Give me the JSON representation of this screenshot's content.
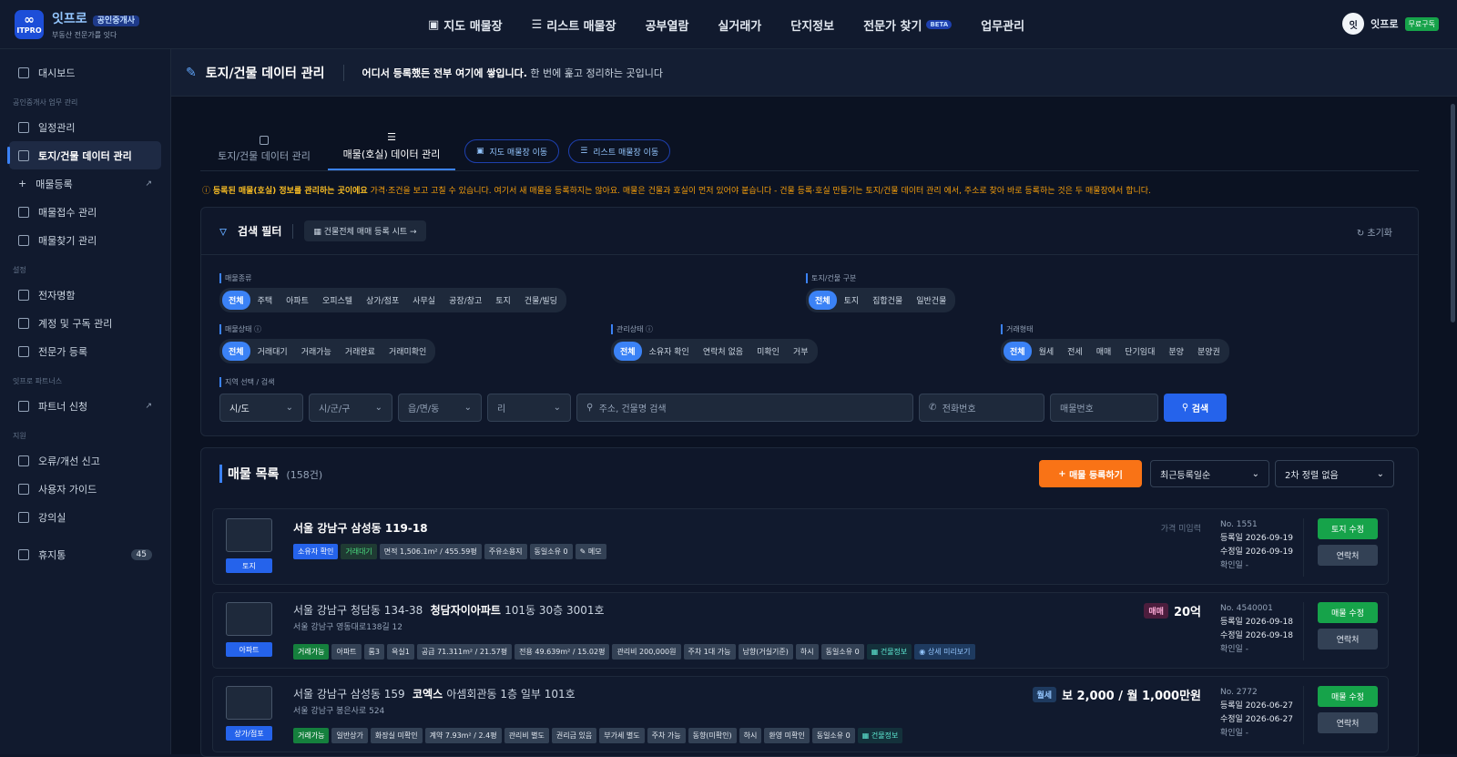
{
  "brand": {
    "name": "잇프로",
    "badge": "공인중개사",
    "tagline": "부동산 전문가를 잇다",
    "logo_text": "ITPRO"
  },
  "nav": [
    "지도 매물장",
    "리스트 매물장",
    "공부열람",
    "실거래가",
    "단지정보",
    "전문가 찾기",
    "업무관리"
  ],
  "nav_beta": "BETA",
  "user": {
    "avatar": "잇",
    "name": "잇프로",
    "plan": "무료구독"
  },
  "sidebar": {
    "dashboard": "대시보드",
    "sec1": "공인중개사 업무 관리",
    "items1": [
      "일정관리",
      "토지/건물 데이터 관리",
      "매물등록",
      "매물접수 관리",
      "매물찾기 관리"
    ],
    "sec2": "설정",
    "items2": [
      "전자명함",
      "계정 및 구독 관리",
      "전문가 등록"
    ],
    "sec3": "잇프로 파트너스",
    "items3": [
      "파트너 신청"
    ],
    "sec4": "지원",
    "items4": [
      "오류/개선 신고",
      "사용자 가이드",
      "강의실"
    ],
    "trash": "휴지통",
    "trash_count": "45"
  },
  "header": {
    "title": "토지/건물 데이터 관리",
    "desc_bold": "어디서 등록했든 전부 여기에 쌓입니다.",
    "desc": " 한 번에 훑고 정리하는 곳입니다"
  },
  "tabs": [
    "토지/건물 데이터 관리",
    "매물(호실) 데이터 관리"
  ],
  "tab_buttons": [
    "지도 매물장 이동",
    "리스트 매물장 이동"
  ],
  "notice": {
    "bold": "등록된 매물(호실) 정보를 관리하는 곳이에요",
    "text": " 가격·조건을 보고 고칠 수 있습니다. 여기서 새 매물을 등록하지는 않아요. 매물은 건물과 호실이 먼저 있어야 붙습니다 - 건물 등록·호실 만들기는 토지/건물 데이터 관리 에서, 주소로 찾아 바로 등록하는 것은 두 매물장에서 합니다."
  },
  "filter": {
    "title": "검색 필터",
    "sheet": "건물전체 매매 등록 시트",
    "reset": "초기화",
    "type_label": "매물종류",
    "types": [
      "전체",
      "주택",
      "아파트",
      "오피스텔",
      "상가/점포",
      "사무실",
      "공장/창고",
      "토지",
      "건물/빌딩"
    ],
    "land_label": "토지/건물 구분",
    "lands": [
      "전체",
      "토지",
      "집합건물",
      "일반건물"
    ],
    "status_label": "매물상태",
    "statuses": [
      "전체",
      "거래대기",
      "거래가능",
      "거래완료",
      "거래미확인"
    ],
    "manage_label": "관리상태",
    "manages": [
      "전체",
      "소유자 확인",
      "연락처 없음",
      "미확인",
      "거부"
    ],
    "deal_label": "거래형태",
    "deals": [
      "전체",
      "월세",
      "전세",
      "매매",
      "단기임대",
      "분양",
      "분양권"
    ],
    "region_label": "지역 선택 / 검색",
    "sido": "시/도",
    "sigungu": "시/군/구",
    "dong": "읍/면/동",
    "ri": "리",
    "addr_ph": "주소, 건물명 검색",
    "phone_ph": "전화번호",
    "no_ph": "매물번호",
    "search": "검색"
  },
  "list": {
    "title": "매물 목록",
    "count": "(158건)",
    "add": "매물 등록하기",
    "sort1": "최근등록일순",
    "sort2": "2차 정렬 없음"
  },
  "cards": [
    {
      "type": "토지",
      "addr": "서울 강남구 삼성동 119-18",
      "tags": [
        "소유자 확인",
        "거래대기",
        "면적 1,506.1m² / 455.59평",
        "주유소용지",
        "동일소유 0",
        "메모"
      ],
      "price_text": "가격 미입력",
      "no": "No. 1551",
      "reg": "등록일 2026-09-19",
      "mod": "수정일 2026-09-19",
      "chk": "확인일 -",
      "edit": "토지 수정",
      "contact": "연락처"
    },
    {
      "type": "아파트",
      "addr": "서울 강남구 청담동 134-38",
      "bld": "청담자이아파트",
      "unit": "101동 30층 3001호",
      "sub": "서울 강남구 영동대로138길 12",
      "tags": [
        "거래가능",
        "아파트",
        "룸3",
        "욕실1",
        "공급 71.311m² / 21.57평",
        "전용 49.639m² / 15.02평",
        "관리비 200,000원",
        "주차 1대 가능",
        "남향(거실기준)",
        "하시",
        "동일소유 0",
        "건물정보",
        "상세 미리보기"
      ],
      "deal": "매매",
      "price": "20억",
      "no": "No. 4540001",
      "reg": "등록일 2026-09-18",
      "mod": "수정일 2026-09-18",
      "chk": "확인일 -",
      "edit": "매물 수정",
      "contact": "연락처"
    },
    {
      "type": "상가/점포",
      "addr": "서울 강남구 삼성동 159",
      "bld": "코엑스",
      "unit": "아셈회관동 1층 일부 101호",
      "sub": "서울 강남구 봉은사로 524",
      "tags": [
        "거래가능",
        "일반상가",
        "화장실 미확인",
        "계약 7.93m² / 2.4평",
        "관리비 별도",
        "권리금 있음",
        "부가세 별도",
        "주차 가능",
        "동향(미확인)",
        "하시",
        "환영 미확인",
        "동일소유 0",
        "건물정보"
      ],
      "deal": "월세",
      "price": "보 2,000 / 월 1,000만원",
      "no": "No. 2772",
      "reg": "등록일 2026-06-27",
      "mod": "수정일 2026-06-27",
      "chk": "확인일 -",
      "edit": "매물 수정",
      "contact": "연락처"
    }
  ]
}
